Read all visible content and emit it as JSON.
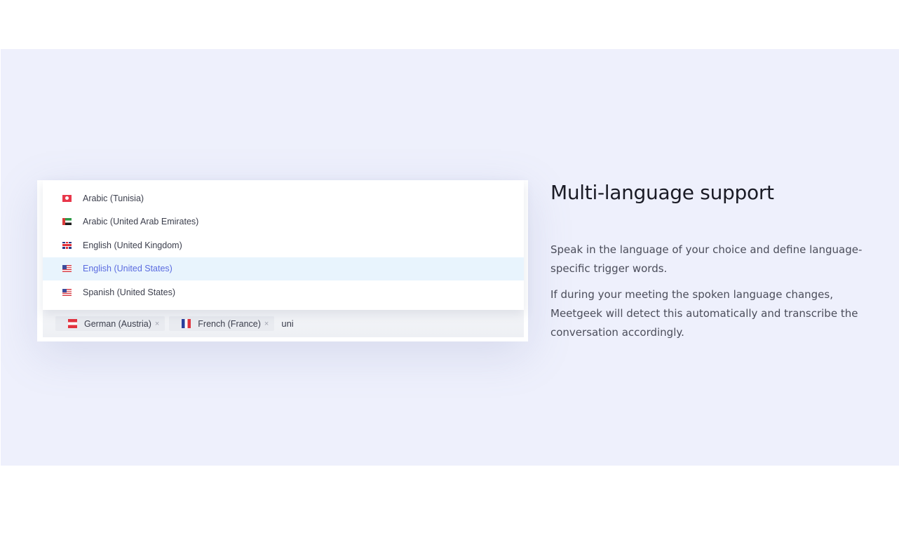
{
  "feature": {
    "title": "Multi-language support",
    "paragraphs": [
      "Speak in the language of your choice and define language-specific trigger words.",
      "If during your meeting the spoken language changes, Meetgeek will detect this automatically and transcribe the conversation accordingly."
    ]
  },
  "language_picker": {
    "options": [
      {
        "label": "Arabic (Tunisia)",
        "flag": "tunisia-flag-icon",
        "selected": false
      },
      {
        "label": "Arabic (United Arab Emirates)",
        "flag": "uae-flag-icon",
        "selected": false
      },
      {
        "label": "English (United Kingdom)",
        "flag": "uk-flag-icon",
        "selected": false
      },
      {
        "label": "English (United States)",
        "flag": "us-flag-icon",
        "selected": true
      },
      {
        "label": "Spanish (United States)",
        "flag": "us-flag-icon",
        "selected": false
      }
    ],
    "chips": [
      {
        "label": "German (Austria)",
        "flag": "austria-flag-icon",
        "remove": "×"
      },
      {
        "label": "French (France)",
        "flag": "france-flag-icon",
        "remove": "×"
      }
    ],
    "input_value": "uni",
    "colors": {
      "selected_bg": "#e8f4fd",
      "selected_text": "#5a6be0",
      "section_bg": "#eef0fc"
    }
  }
}
